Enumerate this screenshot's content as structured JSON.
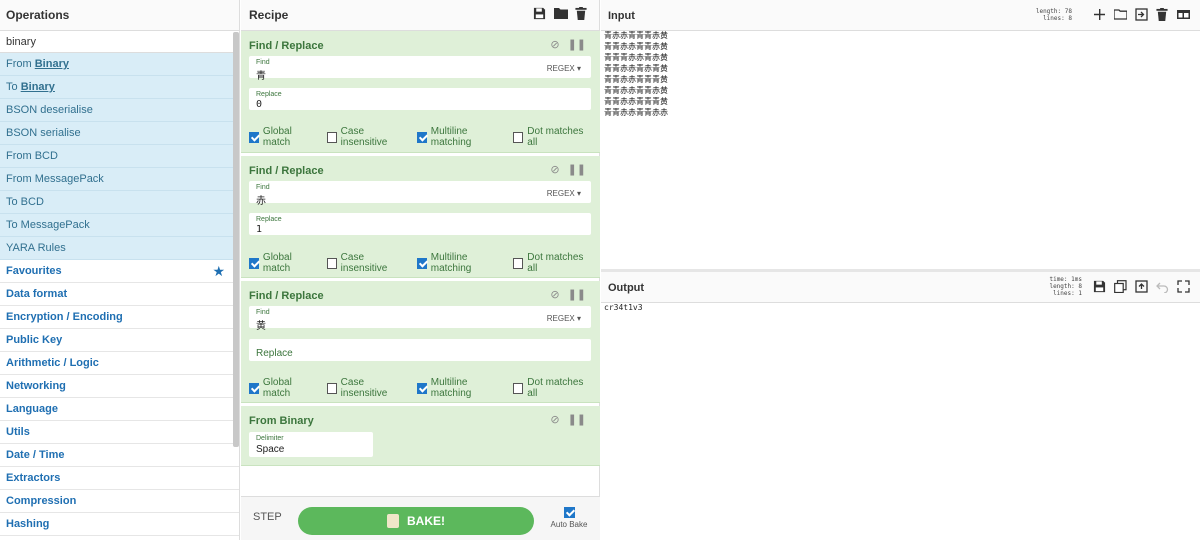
{
  "operations": {
    "title": "Operations",
    "search_value": "binary",
    "results": [
      {
        "pre": "From ",
        "match": "Binary",
        "post": ""
      },
      {
        "pre": "To ",
        "match": "Binary",
        "post": ""
      },
      {
        "pre": "BSON deserialise",
        "match": "",
        "post": ""
      },
      {
        "pre": "BSON serialise",
        "match": "",
        "post": ""
      },
      {
        "pre": "From BCD",
        "match": "",
        "post": ""
      },
      {
        "pre": "From MessagePack",
        "match": "",
        "post": ""
      },
      {
        "pre": "To BCD",
        "match": "",
        "post": ""
      },
      {
        "pre": "To MessagePack",
        "match": "",
        "post": ""
      },
      {
        "pre": "YARA Rules",
        "match": "",
        "post": ""
      }
    ],
    "categories": [
      "Favourites",
      "Data format",
      "Encryption / Encoding",
      "Public Key",
      "Arithmetic / Logic",
      "Networking",
      "Language",
      "Utils",
      "Date / Time",
      "Extractors",
      "Compression",
      "Hashing"
    ]
  },
  "recipe": {
    "title": "Recipe",
    "ops": [
      {
        "name": "Find / Replace",
        "find_label": "Find",
        "find_value": "青",
        "mode": "REGEX ▾",
        "replace_label": "Replace",
        "replace_value": "0",
        "checks": [
          {
            "label": "Global match",
            "on": true
          },
          {
            "label": "Case insensitive",
            "on": false
          },
          {
            "label": "Multiline matching",
            "on": true
          },
          {
            "label": "Dot matches all",
            "on": false
          }
        ]
      },
      {
        "name": "Find / Replace",
        "find_label": "Find",
        "find_value": "赤",
        "mode": "REGEX ▾",
        "replace_label": "Replace",
        "replace_value": "1",
        "checks": [
          {
            "label": "Global match",
            "on": true
          },
          {
            "label": "Case insensitive",
            "on": false
          },
          {
            "label": "Multiline matching",
            "on": true
          },
          {
            "label": "Dot matches all",
            "on": false
          }
        ]
      },
      {
        "name": "Find / Replace",
        "find_label": "Find",
        "find_value": "黄",
        "mode": "REGEX ▾",
        "replace_placeholder": "Replace",
        "checks": [
          {
            "label": "Global match",
            "on": true
          },
          {
            "label": "Case insensitive",
            "on": false
          },
          {
            "label": "Multiline matching",
            "on": true
          },
          {
            "label": "Dot matches all",
            "on": false
          }
        ]
      },
      {
        "name": "From Binary",
        "delimiter_label": "Delimiter",
        "delimiter_value": "Space"
      }
    ],
    "step_label": "STEP",
    "bake_label": "BAKE!",
    "autobake_label": "Auto Bake"
  },
  "input": {
    "title": "Input",
    "length_label": "length:",
    "length_value": "78",
    "lines_label": "lines:",
    "lines_value": "8",
    "text": "青赤赤青青青赤黄\n青青赤赤青青赤黄\n青青青赤赤青赤黄\n青青赤赤青赤青黄\n青青赤赤青青青黄\n青青赤赤青青赤黄\n青青赤赤青青青黄\n青青赤赤青青赤赤"
  },
  "output": {
    "title": "Output",
    "time_label": "time:",
    "time_value": "1ms",
    "length_label": "length:",
    "length_value": "8",
    "lines_label": "lines:",
    "lines_value": "1",
    "text": "cr34t1v3"
  },
  "colors": {
    "accent": "#1f77c9",
    "op_bg": "#dff0d8",
    "op_text": "#3c763d",
    "bake": "#5cb85c",
    "search_bg": "#d9edf7"
  }
}
